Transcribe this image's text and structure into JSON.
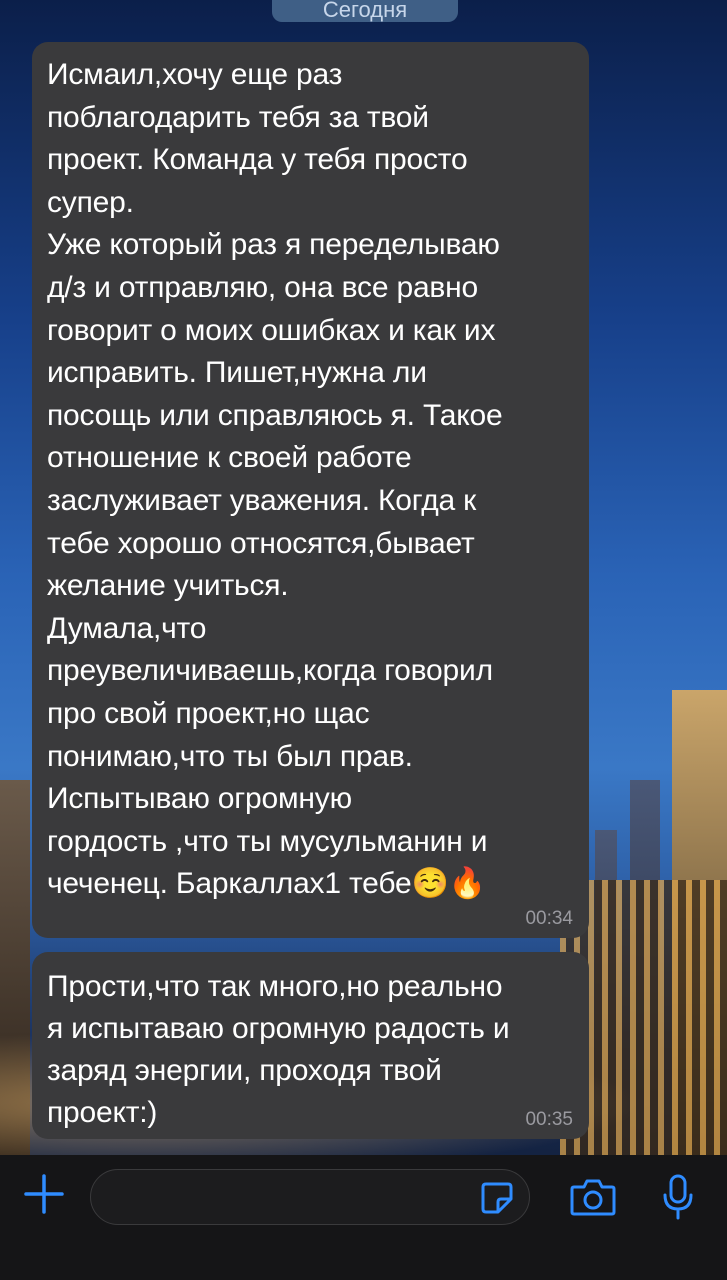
{
  "date_label": "Сегодня",
  "messages": [
    {
      "text": "Исмаил,хочу еще раз\nпоблагодарить тебя за твой\nпроект. Команда у тебя просто\nсупер.\nУже который раз я переделываю\nд/з и отправляю, она все равно\nговорит о моих ошибках и как их\nисправить. Пишет,нужна ли\nпосощь или справляюсь я. Такое\nотношение к своей работе\nзаслуживает уважения. Когда к\nтебе хорошо относятся,бывает\nжелание учиться.\nДумала,что\nпреувеличиваешь,когда говорил\nпро свой проект,но щас\nпонимаю,что ты был прав.\nИспытываю огромную\nгордость ,что ты мусульманин и\nчеченец. Баркаллах1 тебе☺️🔥",
      "time": "00:34"
    },
    {
      "text": "Прости,что так много,но реально\nя испытаваю огромную радость и\nзаряд энергии, проходя твой\nпроект:)",
      "time": "00:35"
    }
  ],
  "input": {
    "placeholder": ""
  },
  "icons": {
    "attach": "plus-icon",
    "sticker": "sticker-icon",
    "camera": "camera-icon",
    "mic": "microphone-icon"
  },
  "colors": {
    "accent": "#2f8cff",
    "bubble": "#3a3a3c",
    "timestamp": "#9a9aa0"
  }
}
